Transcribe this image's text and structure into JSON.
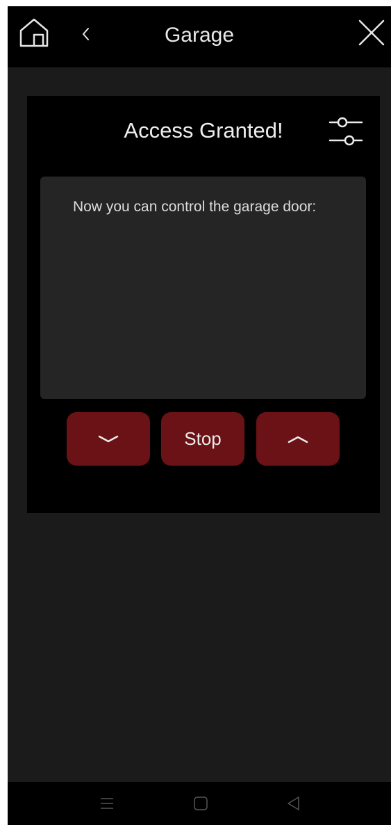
{
  "header": {
    "title": "Garage",
    "home_icon": "home-icon",
    "back_icon": "chevron-left-icon",
    "close_icon": "close-icon"
  },
  "card": {
    "title": "Access Granted!",
    "settings_icon": "sliders-icon",
    "message": "Now you can control the garage door:",
    "buttons": {
      "down_icon": "chevron-down-icon",
      "stop_label": "Stop",
      "up_icon": "chevron-up-icon"
    }
  },
  "system_nav": {
    "menu_icon": "menu-icon",
    "home_icon": "square-icon",
    "back_icon": "triangle-back-icon"
  },
  "colors": {
    "background": "#1b1b1b",
    "bar": "#000000",
    "panel": "#252525",
    "button": "#6a1216",
    "text": "#e8e8e8"
  }
}
